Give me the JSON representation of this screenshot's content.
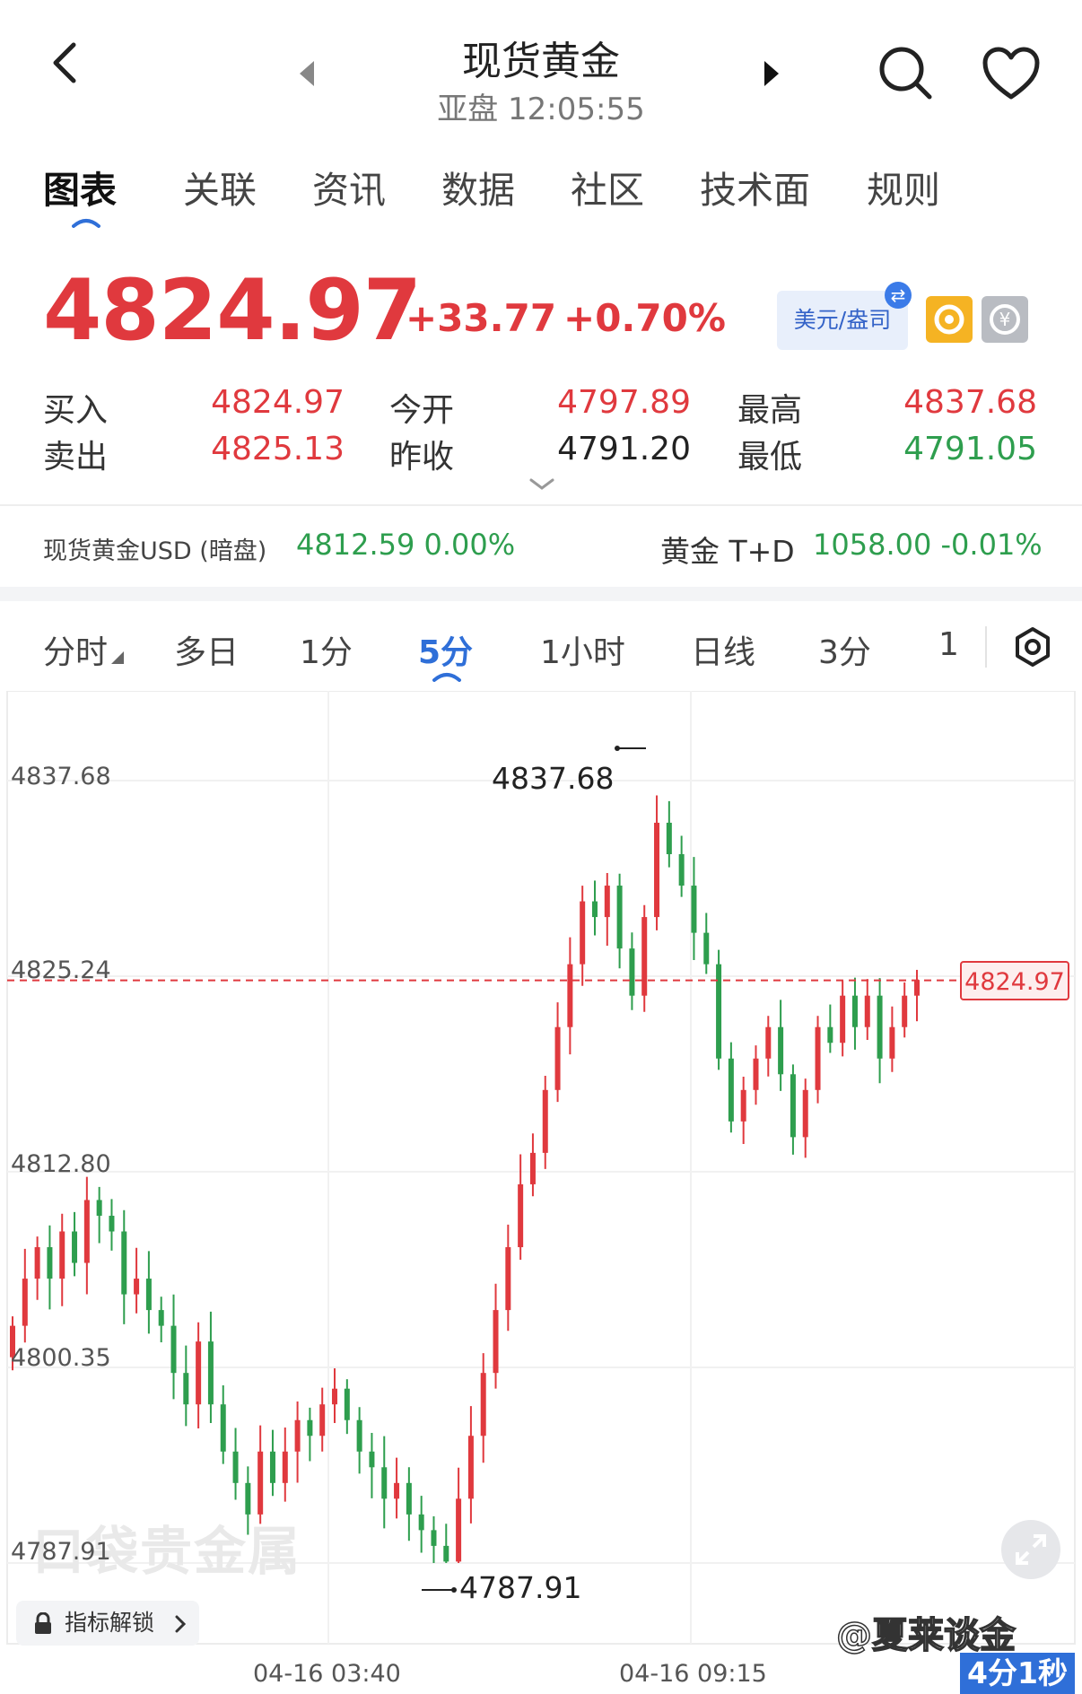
{
  "header": {
    "title": "现货黄金",
    "subtitle": "亚盘 12:05:55"
  },
  "tabs": [
    {
      "label": "图表",
      "active": true
    },
    {
      "label": "关联"
    },
    {
      "label": "资讯"
    },
    {
      "label": "数据"
    },
    {
      "label": "社区"
    },
    {
      "label": "技术面"
    },
    {
      "label": "规则"
    }
  ],
  "quote": {
    "price": "4824.97",
    "change": "+33.77",
    "change_pct": "+0.70%",
    "currency": "美元/盎司",
    "bid_label": "买入",
    "bid": "4824.97",
    "ask_label": "卖出",
    "ask": "4825.13",
    "open_label": "今开",
    "open": "4797.89",
    "prev_close_label": "昨收",
    "prev_close": "4791.20",
    "high_label": "最高",
    "high": "4837.68",
    "low_label": "最低",
    "low": "4791.05"
  },
  "related": {
    "item1_name": "现货黄金USD (暗盘)",
    "item1_value": "4812.59 0.00%",
    "item2_name": "黄金 T+D",
    "item2_value": "1058.00 -0.01%"
  },
  "periods": [
    {
      "label": "分时",
      "dropdown": true
    },
    {
      "label": "多日"
    },
    {
      "label": "1分"
    },
    {
      "label": "5分",
      "active": true
    },
    {
      "label": "1小时"
    },
    {
      "label": "日线"
    },
    {
      "label": "3分"
    },
    {
      "label": "1"
    }
  ],
  "chart_labels": {
    "y_ticks": [
      "4837.68",
      "4825.24",
      "4812.80",
      "4800.35",
      "4787.91"
    ],
    "x_ticks": [
      "04-16 03:40",
      "04-16 09:15"
    ],
    "high_marker": "4837.68",
    "low_marker": "4787.91",
    "last_price_tag": "4824.97",
    "watermark": "口袋贵金属",
    "unlock_label": "指标解锁",
    "author": "@夏莱谈金",
    "timer": "4分1秒"
  },
  "colors": {
    "up": "#e0393e",
    "down": "#2e9e4e",
    "accent": "#2f6fd8"
  },
  "chart_data": {
    "type": "candlestick",
    "ylim": [
      4787.91,
      4837.68
    ],
    "ytick_values": [
      4837.68,
      4825.24,
      4812.8,
      4800.35,
      4787.91
    ],
    "last_price": 4824.97,
    "high": 4837.68,
    "low": 4787.91,
    "x_ticks": [
      "04-16 03:40",
      "04-16 09:15"
    ],
    "grid": true,
    "close_series": [
      4803,
      4806,
      4808,
      4806,
      4809,
      4807,
      4811,
      4810,
      4809,
      4805,
      4806,
      4804,
      4803,
      4800,
      4798,
      4802,
      4798,
      4795,
      4793,
      4791,
      4795,
      4793,
      4795,
      4797,
      4796,
      4798,
      4799,
      4797,
      4795,
      4794,
      4792,
      4793,
      4791,
      4790,
      4789,
      4788,
      4792,
      4796,
      4800,
      4804,
      4808,
      4812,
      4814,
      4818,
      4822,
      4826,
      4830,
      4829,
      4831,
      4827,
      4824,
      4829,
      4835,
      4833,
      4831,
      4828,
      4826,
      4820,
      4816,
      4818,
      4820,
      4822,
      4819,
      4815,
      4818,
      4822,
      4821,
      4824,
      4822,
      4824,
      4820,
      4822,
      4824,
      4825
    ]
  }
}
